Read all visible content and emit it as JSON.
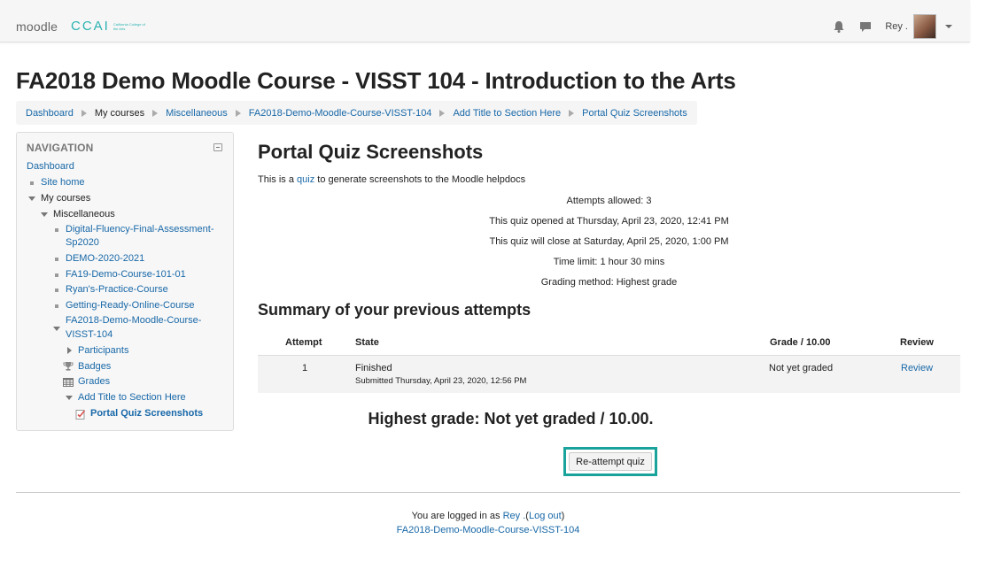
{
  "navbar": {
    "brand": "moodle",
    "school_mark": "CCAI",
    "school_name": "California College of the Arts",
    "user_name": "Rey ."
  },
  "header": {
    "course_title": "FA2018 Demo Moodle Course - VISST 104 - Introduction to the Arts",
    "breadcrumb": [
      "Dashboard",
      "My courses",
      "Miscellaneous",
      "FA2018-Demo-Moodle-Course-VISST-104",
      "Add Title to Section Here",
      "Portal Quiz Screenshots"
    ]
  },
  "navigation": {
    "heading": "NAVIGATION",
    "items": [
      "Dashboard",
      "Site home",
      "My courses",
      "Miscellaneous",
      "Digital-Fluency-Final-Assessment-",
      "Sp2020",
      "DEMO-2020-2021",
      "FA19-Demo-Course-101-01",
      "Ryan's-Practice-Course",
      "Getting-Ready-Online-Course",
      "FA2018-Demo-Moodle-Course-",
      "VISST-104",
      "Participants",
      "Badges",
      "Grades",
      "Add Title to Section Here",
      "Portal Quiz Screenshots"
    ]
  },
  "quiz": {
    "title": "Portal Quiz Screenshots",
    "intro_before": "This is a",
    "intro_link": "quiz",
    "intro_after": "to generate screenshots to the Moodle helpdocs",
    "info": [
      "Attempts allowed: 3",
      "This quiz opened at Thursday, April 23, 2020, 12:41 PM",
      "This quiz will close at Saturday, April 25, 2020, 1:00 PM",
      "Time limit: 1 hour 30 mins",
      "Grading method: Highest grade"
    ],
    "summary_title": "Summary of your previous attempts",
    "columns": [
      "Attempt",
      "State",
      "Grade / 10.00",
      "Review"
    ],
    "rows": [
      {
        "attempt": "1",
        "state": "Finished",
        "submitted": "Submitted Thursday, April 23, 2020, 12:56 PM",
        "grade": "Not yet graded",
        "review": "Review"
      }
    ],
    "highest_grade": "Highest grade: Not yet graded / 10.00.",
    "reattempt_label": "Re-attempt quiz"
  },
  "footer": {
    "logged_in_prefix": "You are logged in as",
    "user": "Rey .",
    "logout_open": "(",
    "logout": "Log out",
    "logout_close": ")",
    "course_link": "FA2018-Demo-Moodle-Course-VISST-104"
  },
  "colors": {
    "link": "#1868a8",
    "highlight": "#1aa39b",
    "brand_accent": "#2bb3b1"
  }
}
